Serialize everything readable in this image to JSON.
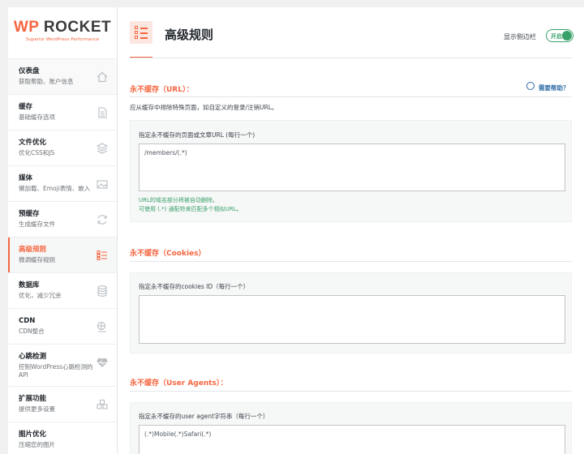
{
  "logo": {
    "wp": "WP",
    "rocket": " ROCKET",
    "tagline": "Superior WordPress Performance"
  },
  "nav": [
    {
      "title": "仪表盘",
      "sub": "获取帮助、账户信息",
      "icon": "home-icon"
    },
    {
      "title": "缓存",
      "sub": "基础缓存选项",
      "icon": "document-icon"
    },
    {
      "title": "文件优化",
      "sub": "优化CSS和JS",
      "icon": "layers-icon"
    },
    {
      "title": "媒体",
      "sub": "懒加载、Emoji表情、嵌入",
      "icon": "image-icon"
    },
    {
      "title": "预缓存",
      "sub": "生成缓存文件",
      "icon": "refresh-icon"
    },
    {
      "title": "高级规则",
      "sub": "微调缓存规则",
      "icon": "list-icon"
    },
    {
      "title": "数据库",
      "sub": "优化，减少冗余",
      "icon": "database-icon"
    },
    {
      "title": "CDN",
      "sub": "CDN整合",
      "icon": "cdn-icon"
    },
    {
      "title": "心跳检测",
      "sub": "控制WordPress心跳检测的API",
      "icon": "heartbeat-icon"
    },
    {
      "title": "扩展功能",
      "sub": "提供更多设置",
      "icon": "addons-icon"
    },
    {
      "title": "图片优化",
      "sub": "压缩您的图片",
      "icon": "image-optimize-icon"
    }
  ],
  "header": {
    "title": "高级规则",
    "sidebar_toggle_label": "显示侧边栏",
    "toggle_text": "开启"
  },
  "sections": {
    "url": {
      "title": "永不缓存（URL）：",
      "help": "需要帮助？",
      "desc": "应从缓存中排除特殊页面，如自定义的登录/注销URL。",
      "field_label": "指定永不缓存的页面或文章URL (每行一个)",
      "value": "/members/(.*)",
      "hint1": "URL的域名部分将被自动删除。",
      "hint2": "可使用 (.*) 通配符来匹配多个相似URL。"
    },
    "cookies": {
      "title": "永不缓存（Cookies）",
      "field_label": "指定永不缓存的cookies ID（每行一个）",
      "value": ""
    },
    "agents": {
      "title": "永不缓存（User Agents）：",
      "field_label": "指定永不缓存的user agent字符串（每行一个）",
      "value": "(.*)Mobile(.*)Safari(.*)"
    }
  },
  "colors": {
    "accent": "#f56640",
    "success": "#38a169",
    "link": "#2d6aa6"
  }
}
